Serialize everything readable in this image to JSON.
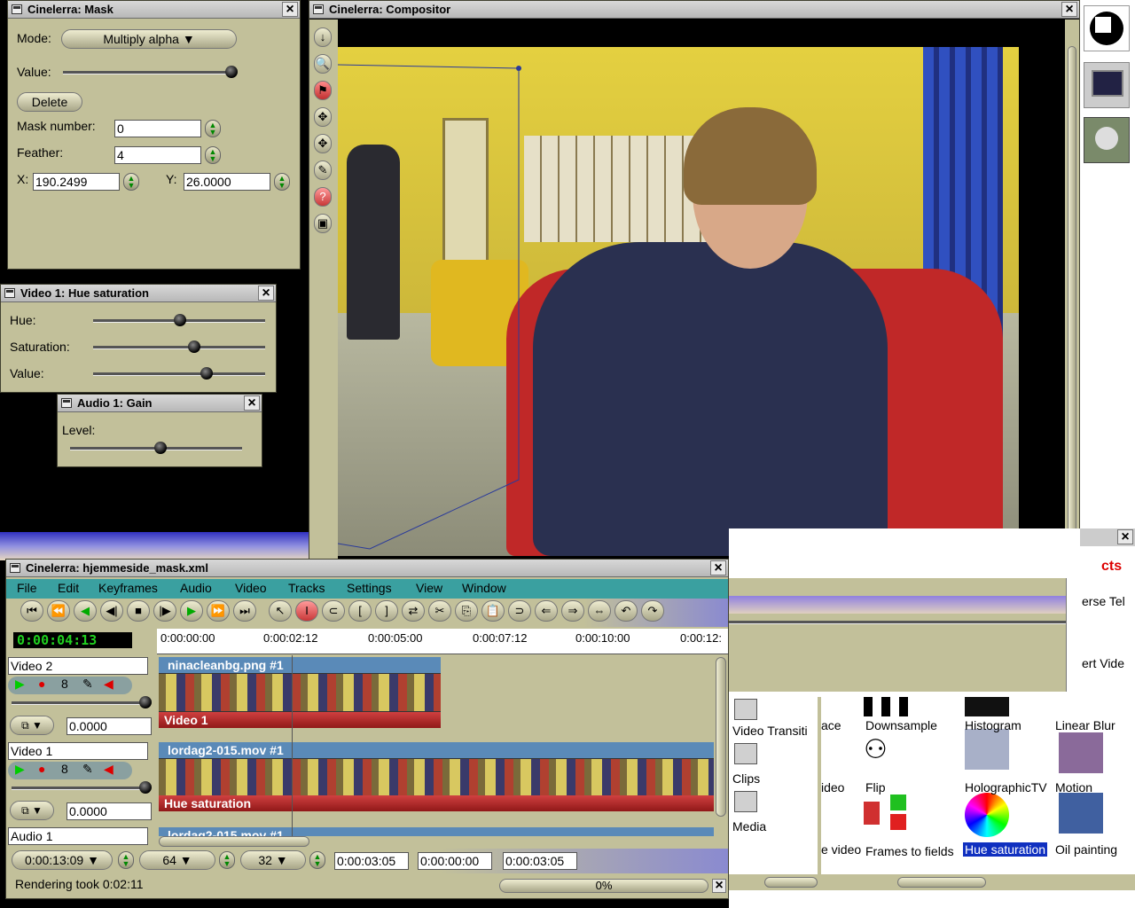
{
  "mask": {
    "title": "Cinelerra: Mask",
    "mode_label": "Mode:",
    "mode_value": "Multiply alpha",
    "value_label": "Value:",
    "value_level": 0.95,
    "delete_label": "Delete",
    "mask_number_label": "Mask number:",
    "mask_number": "0",
    "feather_label": "Feather:",
    "feather": "4",
    "x_label": "X:",
    "x_value": "190.2499",
    "y_label": "Y:",
    "y_value": "26.0000"
  },
  "hue_sat": {
    "title": "Video 1: Hue saturation",
    "hue_label": "Hue:",
    "hue_level": 0.5,
    "saturation_label": "Saturation:",
    "saturation_level": 0.6,
    "value_label": "Value:",
    "value_level": 0.66
  },
  "gain": {
    "title": "Audio 1: Gain",
    "level_label": "Level:",
    "level_value": 0.52
  },
  "compositor": {
    "title": "Cinelerra: Compositor",
    "tools": [
      "arrow-down-icon",
      "zoom-icon",
      "mask-icon",
      "move-icon",
      "crop-icon",
      "pen-icon",
      "help-icon",
      "safe-region-icon"
    ]
  },
  "main": {
    "title": "Cinelerra: hjemmeside_mask.xml",
    "menu": [
      "File",
      "Edit",
      "Keyframes",
      "Audio",
      "Video",
      "Tracks",
      "Settings",
      "View",
      "Window"
    ],
    "clock": "0:00:04:13",
    "ruler": [
      "0:00:00:00",
      "0:00:02:12",
      "0:00:05:00",
      "0:00:07:12",
      "0:00:10:00",
      "0:00:12:"
    ],
    "tracks": [
      {
        "name": "Video 2",
        "fade": "0.0000",
        "clip": "ninacleanbg.png #1",
        "effect": "Video 1"
      },
      {
        "name": "Video 1",
        "fade": "0.0000",
        "clip": "lordag2-015.mov #1",
        "effect": "Hue saturation"
      },
      {
        "name": "Audio 1",
        "clip": "lordag2-015.mov #1"
      }
    ],
    "zoom_time": "0:00:13:09",
    "zoom_samples": "64",
    "zoom_height": "32",
    "pos_selection": "0:00:03:05",
    "pos_length": "0:00:00:00",
    "pos_end": "0:00:03:05",
    "status": "Rendering took 0:02:11",
    "progress": "0%"
  },
  "resources": {
    "folders": [
      "Video Transiti",
      "Clips",
      "Media"
    ],
    "effects": [
      "ace",
      "Downsample",
      "Histogram",
      "Linear Blur",
      "ideo",
      "Flip",
      "HolographicTV",
      "Motion",
      "e video",
      "Frames to fields",
      "Hue saturation",
      "Oil painting"
    ],
    "partial_labels": [
      "cts",
      "erse Tel",
      "ert Vide"
    ]
  }
}
